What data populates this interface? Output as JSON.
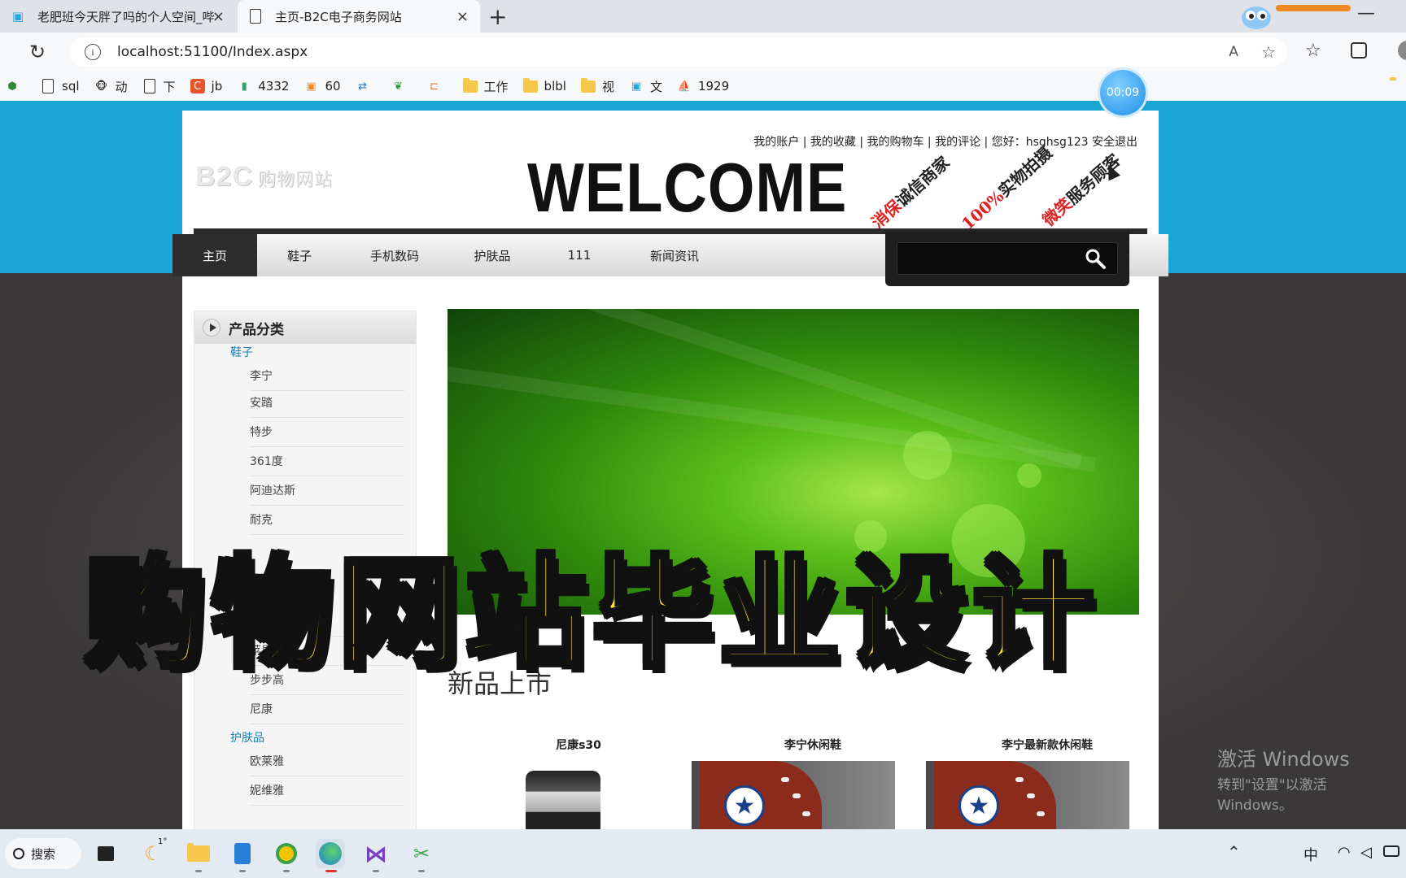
{
  "browser": {
    "tabs": [
      {
        "title": "老肥班今天胖了吗的个人空间_哔"
      },
      {
        "title": "主页-B2C电子商务网站"
      }
    ],
    "url": "localhost:51100/Index.aspx",
    "timer": "00:09",
    "bookmarks": [
      {
        "label": "sql",
        "icon": "page-icon"
      },
      {
        "label": "动",
        "icon": "monkey-icon"
      },
      {
        "label": "下",
        "icon": "page-icon"
      },
      {
        "label": "jb",
        "icon": "c-logo-icon"
      },
      {
        "label": "4332",
        "icon": "book-icon"
      },
      {
        "label": "60",
        "icon": "gift-icon"
      },
      {
        "label": "",
        "icon": "translate-icon"
      },
      {
        "label": "",
        "icon": "leaf-icon"
      },
      {
        "label": "",
        "icon": "bracket-icon"
      },
      {
        "label": "工作",
        "icon": "folder-icon"
      },
      {
        "label": "blbl",
        "icon": "folder-icon"
      },
      {
        "label": "视",
        "icon": "folder-icon"
      },
      {
        "label": "文",
        "icon": "bilibili-icon"
      },
      {
        "label": "1929",
        "icon": "boat-icon"
      }
    ]
  },
  "site": {
    "logo": "B2C",
    "logo_small": "购物网站",
    "welcome": "WELCOME",
    "toplinks": "我的账户 | 我的收藏 | 我的购物车 | 我的评论 | 您好：hsghsg123 安全退出",
    "stamps": [
      {
        "red": "消保",
        "black": "诚信商家"
      },
      {
        "red": "100%",
        "black": "实物拍摄"
      },
      {
        "red": "微笑",
        "black": "服务顾客"
      }
    ],
    "nav": [
      "主页",
      "鞋子",
      "手机数码",
      "护肤品",
      "111",
      "新闻资讯"
    ],
    "search_value": "",
    "sidebar": {
      "title": "产品分类",
      "categories": [
        {
          "name": "鞋子"
        },
        {
          "name": "护肤品"
        }
      ],
      "shoe_brands": [
        "李宁",
        "安踏",
        "特步",
        "361度",
        "阿迪达斯",
        "耐克"
      ],
      "digital_brands": [
        "佳",
        "苹果",
        "步步高",
        "尼康"
      ],
      "skincare_brands": [
        "欧莱雅",
        "妮维雅"
      ]
    },
    "new_title": "新品上市",
    "products": [
      {
        "name": "尼康s30"
      },
      {
        "name": "李宁休闲鞋"
      },
      {
        "name": "李宁最新款休闲鞋"
      }
    ]
  },
  "overlay_title": "购物网站毕业设计",
  "watermark": {
    "line1": "激活 Windows",
    "line2": "转到\"设置\"以激活 Windows。"
  },
  "taskbar": {
    "search_label": "搜索",
    "weather": "1°",
    "ime": "中"
  },
  "colors": {
    "accent_blue": "#19a6d3",
    "link": "#1a7fb0",
    "overlay_yellow": "#ffe23a"
  }
}
